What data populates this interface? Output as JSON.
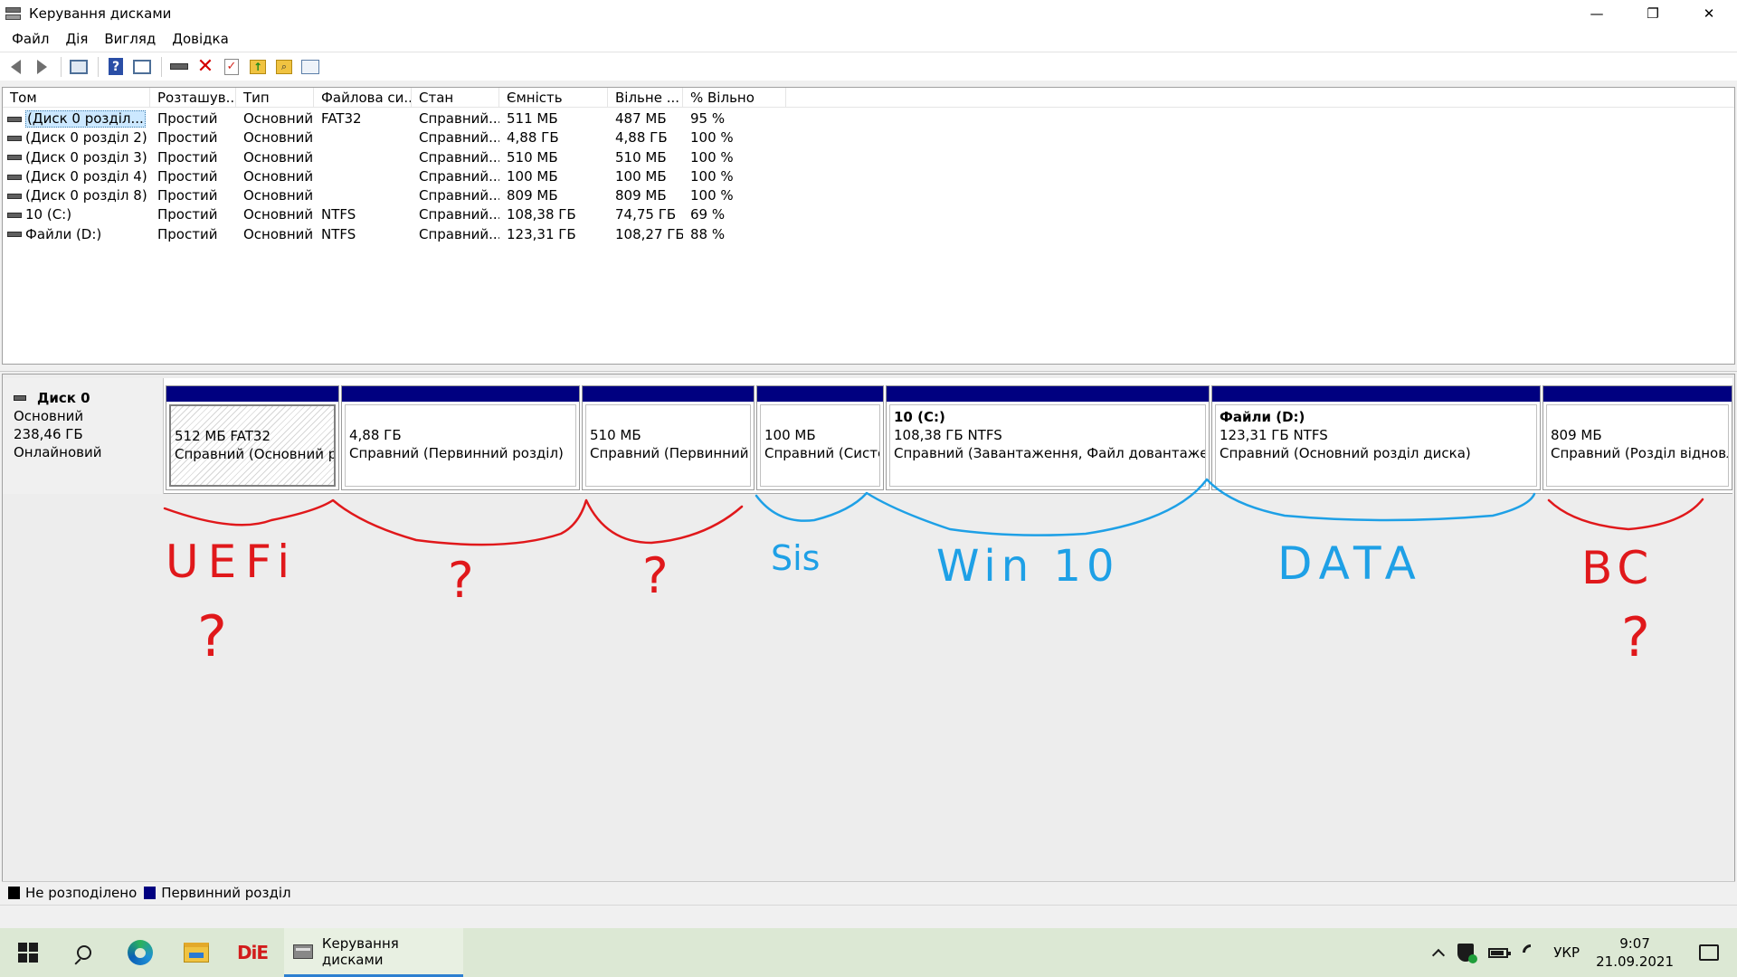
{
  "window": {
    "title": "Керування дисками",
    "controls": {
      "minimize": "—",
      "maximize": "❐",
      "close": "✕"
    }
  },
  "menu": [
    "Файл",
    "Дія",
    "Вигляд",
    "Довідка"
  ],
  "toolbar_icons": [
    "back-arrow-icon",
    "forward-arrow-icon",
    "window-icon",
    "help-icon",
    "list-icon",
    "disk-icon",
    "delete-icon",
    "check-icon",
    "folder-up-icon",
    "folder-search-icon",
    "properties-icon"
  ],
  "volume_list": {
    "columns": [
      "Том",
      "Розташув...",
      "Тип",
      "Файлова си...",
      "Стан",
      "Ємність",
      "Вільне ...",
      "% Вільно"
    ],
    "rows": [
      {
        "name": "(Диск 0 розділ...",
        "layout": "Простий",
        "type": "Основний",
        "fs": "FAT32",
        "status": "Справний...",
        "capacity": "511 МБ",
        "free": "487 МБ",
        "pct": "95 %"
      },
      {
        "name": "(Диск 0 розділ 2)",
        "layout": "Простий",
        "type": "Основний",
        "fs": "",
        "status": "Справний...",
        "capacity": "4,88 ГБ",
        "free": "4,88 ГБ",
        "pct": "100 %"
      },
      {
        "name": "(Диск 0 розділ 3)",
        "layout": "Простий",
        "type": "Основний",
        "fs": "",
        "status": "Справний...",
        "capacity": "510 МБ",
        "free": "510 МБ",
        "pct": "100 %"
      },
      {
        "name": "(Диск 0 розділ 4)",
        "layout": "Простий",
        "type": "Основний",
        "fs": "",
        "status": "Справний...",
        "capacity": "100 МБ",
        "free": "100 МБ",
        "pct": "100 %"
      },
      {
        "name": "(Диск 0 розділ 8)",
        "layout": "Простий",
        "type": "Основний",
        "fs": "",
        "status": "Справний...",
        "capacity": "809 МБ",
        "free": "809 МБ",
        "pct": "100 %"
      },
      {
        "name": "10 (C:)",
        "layout": "Простий",
        "type": "Основний",
        "fs": "NTFS",
        "status": "Справний...",
        "capacity": "108,38 ГБ",
        "free": "74,75 ГБ",
        "pct": "69 %"
      },
      {
        "name": "Файли (D:)",
        "layout": "Простий",
        "type": "Основний",
        "fs": "NTFS",
        "status": "Справний...",
        "capacity": "123,31 ГБ",
        "free": "108,27 ГБ",
        "pct": "88 %"
      }
    ]
  },
  "disk": {
    "title": "Диск 0",
    "type": "Основний",
    "size": "238,46 ГБ",
    "state": "Онлайновий",
    "partitions": [
      {
        "title": "",
        "size": "512 МБ FAT32",
        "status": "Справний (Основний роз"
      },
      {
        "title": "",
        "size": "4,88 ГБ",
        "status": "Справний (Первинний розділ)"
      },
      {
        "title": "",
        "size": "510 МБ",
        "status": "Справний (Первинний ро"
      },
      {
        "title": "",
        "size": "100 МБ",
        "status": "Справний (Систем"
      },
      {
        "title": "10  (C:)",
        "size": "108,38 ГБ NTFS",
        "status": "Справний (Завантаження, Файл довантаження, Ав"
      },
      {
        "title": "Файли  (D:)",
        "size": "123,31 ГБ NTFS",
        "status": "Справний (Основний розділ диска)"
      },
      {
        "title": "",
        "size": "809 МБ",
        "status": "Справний (Розділ відновлен"
      }
    ]
  },
  "annotations": {
    "red": [
      "UEFi",
      "?",
      "?",
      "?",
      "BC",
      "?"
    ],
    "blue": [
      "Sis",
      "Win 10",
      "DATA"
    ],
    "colors": {
      "red": "#e0181b",
      "blue": "#1ea0e6"
    }
  },
  "legend": {
    "unallocated": "Не розподілено",
    "primary": "Первинний розділ"
  },
  "colors": {
    "partition_bar": "#000080",
    "taskbar": "#dce8d4"
  },
  "taskbar": {
    "active_app": "Керування дисками",
    "die_label": "DiE",
    "language": "УКР",
    "time": "9:07",
    "date": "21.09.2021"
  }
}
